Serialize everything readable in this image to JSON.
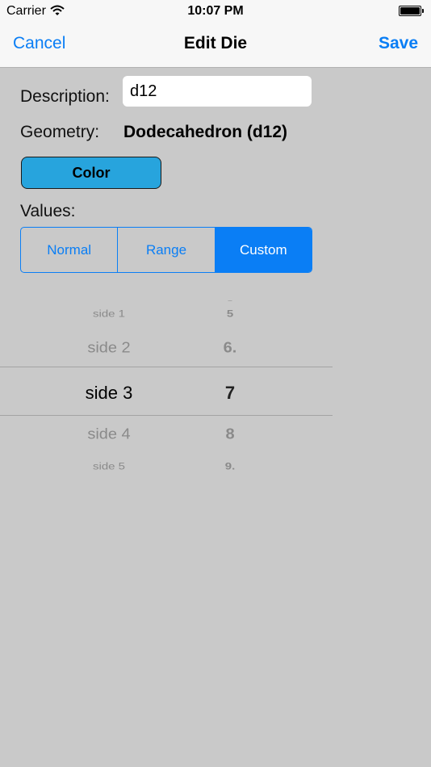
{
  "status_bar": {
    "carrier": "Carrier",
    "time": "10:07 PM",
    "icons": [
      "wifi-icon",
      "battery-icon"
    ]
  },
  "nav": {
    "cancel_label": "Cancel",
    "title": "Edit Die",
    "save_label": "Save"
  },
  "form": {
    "description_label": "Description:",
    "description_value": "d12",
    "geometry_label": "Geometry:",
    "geometry_value": "Dodecahedron (d12)",
    "color_button_label": "Color",
    "values_label": "Values:",
    "segments": [
      {
        "label": "Normal",
        "selected": false
      },
      {
        "label": "Range",
        "selected": false
      },
      {
        "label": "Custom",
        "selected": true
      }
    ]
  },
  "picker": {
    "rows": [
      {
        "side": "side 1",
        "value": "5"
      },
      {
        "side": "side 2",
        "value": "6."
      },
      {
        "side": "side 3",
        "value": "7"
      },
      {
        "side": "side 4",
        "value": "8"
      },
      {
        "side": "side 5",
        "value": "9."
      }
    ],
    "selected_row": "side 3"
  },
  "colors": {
    "accent": "#0a7ef5",
    "color_button": "#27a4dd",
    "background": "#c9c9c9",
    "bar_background": "#f7f7f7"
  }
}
